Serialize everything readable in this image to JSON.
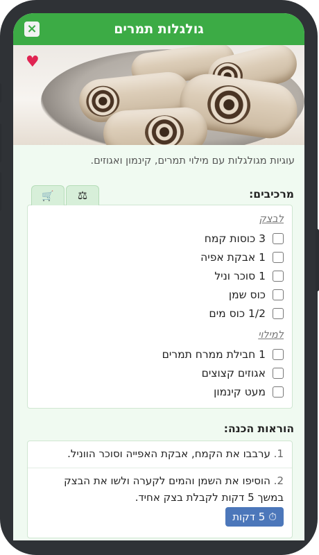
{
  "header": {
    "title": "גולגלות תמרים",
    "close_icon": "×"
  },
  "hero": {
    "favorite_icon": "♥"
  },
  "description": "עוגיות מגולגלות עם מילוי תמרים, קינמון ואגוזים.",
  "ingredients": {
    "title": "מרכיבים:",
    "tabs": {
      "scale_icon": "⚖",
      "cart_icon": "🛒"
    },
    "groups": [
      {
        "label": "לבצק",
        "items": [
          "3 כוסות קמח",
          "1 אבקת אפיה",
          "1 סוכר וניל",
          "כוס שמן",
          "1/2 כוס מים"
        ]
      },
      {
        "label": "למילוי",
        "items": [
          "1 חבילת ממרח תמרים",
          "אגוזים קצוצים",
          "מעט קינמון"
        ]
      }
    ]
  },
  "instructions": {
    "title": "הוראות הכנה:",
    "steps": [
      {
        "num": "1.",
        "text": "ערבבו את הקמח, אבקת האפייה וסוכר הווניל."
      },
      {
        "num": "2.",
        "text": "הוסיפו את השמן והמים לקערה ולשו את הבצק במשך 5 דקות לקבלת בצק אחיד."
      }
    ],
    "timer_label": "5 דקות",
    "timer_icon": "⏱"
  }
}
